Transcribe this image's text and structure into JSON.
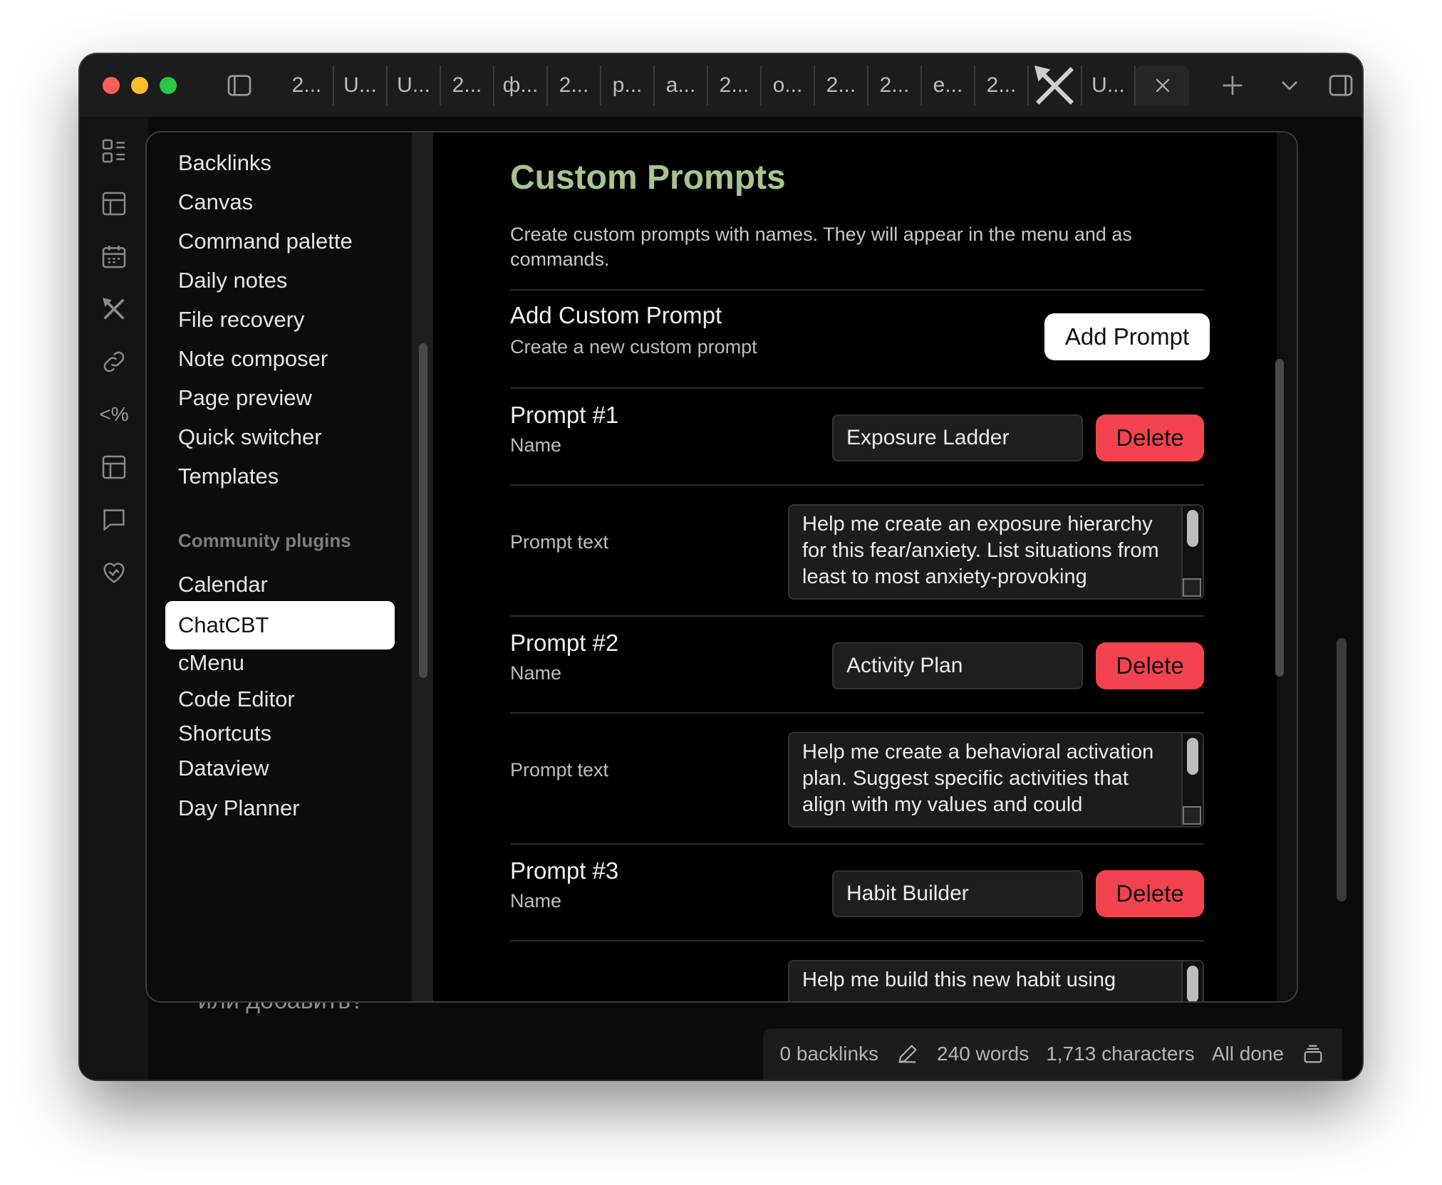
{
  "window": {
    "tabs": [
      "2...",
      "U...",
      "U...",
      "2...",
      "ф...",
      "2...",
      "р...",
      "a...",
      "2...",
      "о...",
      "2...",
      "2...",
      "е...",
      "2..."
    ],
    "active_tab": "U..."
  },
  "ribbon": {
    "items": [
      "dashboard-icon",
      "table-icon",
      "calendar-icon",
      "tools-icon",
      "link-icon",
      "template-symbol",
      "layout-icon",
      "chat-icon",
      "heart-icon"
    ],
    "template_symbol_text": "<%"
  },
  "settings_nav": {
    "core_items": [
      "Backlinks",
      "Canvas",
      "Command palette",
      "Daily notes",
      "File recovery",
      "Note composer",
      "Page preview",
      "Quick switcher",
      "Templates"
    ],
    "community_heading": "Community plugins",
    "community_items": [
      "Calendar",
      "ChatCBT",
      "cMenu",
      "Code Editor Shortcuts",
      "Dataview",
      "Day Planner"
    ],
    "active_item": "ChatCBT"
  },
  "content": {
    "title": "Custom Prompts",
    "description": "Create custom prompts with names. They will appear in the menu and as commands.",
    "add_setting": {
      "name": "Add Custom Prompt",
      "desc": "Create a new custom prompt",
      "button": "Add Prompt"
    },
    "name_label": "Name",
    "text_label": "Prompt text",
    "delete_label": "Delete",
    "prompts": [
      {
        "heading": "Prompt #1",
        "name": "Exposure Ladder",
        "text": "Help me create an exposure hierarchy for this fear/anxiety. List situations from least to most anxiety-provoking"
      },
      {
        "heading": "Prompt #2",
        "name": "Activity Plan",
        "text": "Help me create a behavioral activation plan. Suggest specific activities that align with my values and could"
      },
      {
        "heading": "Prompt #3",
        "name": "Habit Builder",
        "text": "Help me build this new habit using"
      }
    ]
  },
  "editor": {
    "background_text": "или добавить?"
  },
  "status_bar": {
    "backlinks": "0 backlinks",
    "words": "240 words",
    "characters": "1,713 characters",
    "sync": "All done"
  },
  "colors": {
    "accent_title": "#a8c48e",
    "delete_button": "#f2434f",
    "background": "#000000"
  }
}
